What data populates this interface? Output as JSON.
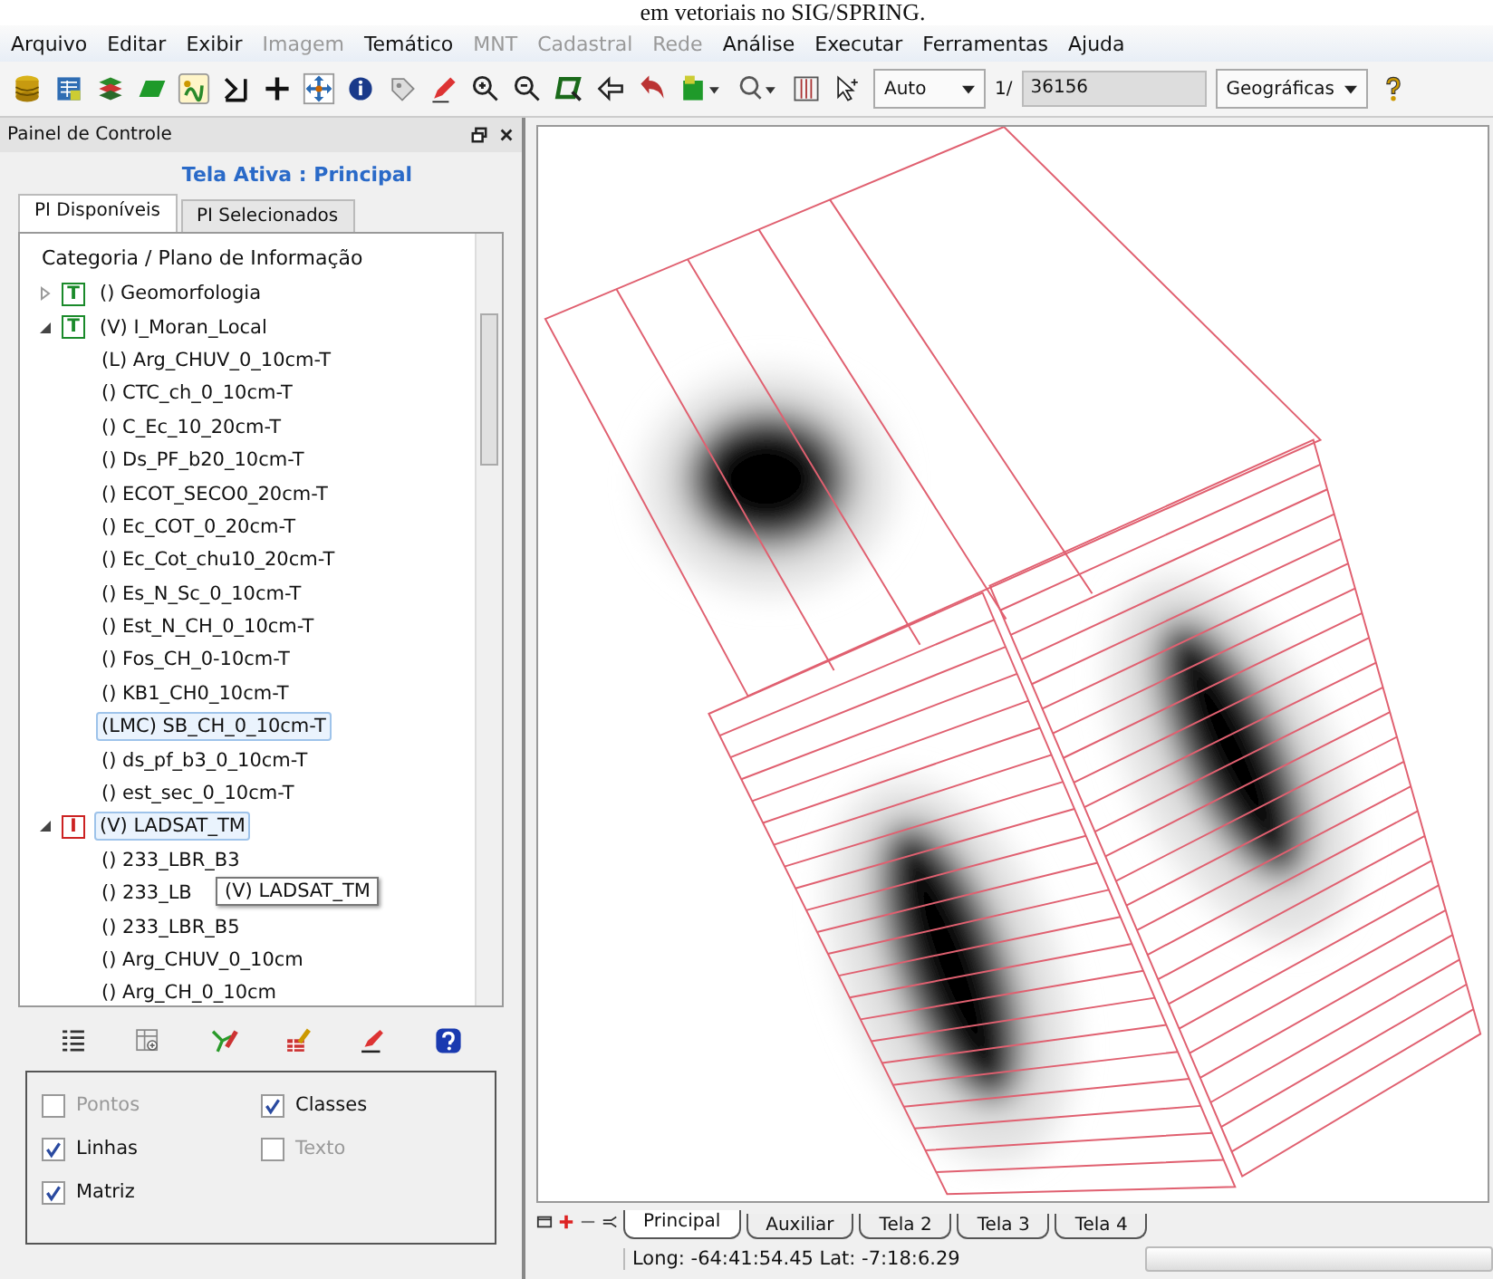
{
  "caption": "em vetoriais no SIG/SPRING.",
  "menu": [
    {
      "label": "Arquivo",
      "disabled": false
    },
    {
      "label": "Editar",
      "disabled": false
    },
    {
      "label": "Exibir",
      "disabled": false
    },
    {
      "label": "Imagem",
      "disabled": true
    },
    {
      "label": "Temático",
      "disabled": false
    },
    {
      "label": "MNT",
      "disabled": true
    },
    {
      "label": "Cadastral",
      "disabled": true
    },
    {
      "label": "Rede",
      "disabled": true
    },
    {
      "label": "Análise",
      "disabled": false
    },
    {
      "label": "Executar",
      "disabled": false
    },
    {
      "label": "Ferramentas",
      "disabled": false
    },
    {
      "label": "Ajuda",
      "disabled": false
    }
  ],
  "toolbar": {
    "zoom_mode": "Auto",
    "scale_prefix": "1/",
    "scale": "36156",
    "projection": "Geográficas"
  },
  "panel": {
    "title": "Painel de Controle",
    "active_screen": "Tela Ativa : Principal",
    "tabs": [
      {
        "label": "PI Disponíveis",
        "selected": true
      },
      {
        "label": "PI Selecionados",
        "selected": false
      }
    ],
    "tree_header": "Categoria / Plano de Informação",
    "tree": [
      {
        "label": "() Geomorfologia",
        "badge": "T",
        "color": "#1a8a2a",
        "expanded": false,
        "selected": false
      },
      {
        "label": "(V) I_Moran_Local",
        "badge": "T",
        "color": "#1a8a2a",
        "expanded": true,
        "selected": false,
        "children": [
          {
            "label": "(L) Arg_CHUV_0_10cm-T",
            "selected": false
          },
          {
            "label": "() CTC_ch_0_10cm-T",
            "selected": false
          },
          {
            "label": "() C_Ec_10_20cm-T",
            "selected": false
          },
          {
            "label": "() Ds_PF_b20_10cm-T",
            "selected": false
          },
          {
            "label": "() ECOT_SECO0_20cm-T",
            "selected": false
          },
          {
            "label": "() Ec_COT_0_20cm-T",
            "selected": false
          },
          {
            "label": "() Ec_Cot_chu10_20cm-T",
            "selected": false
          },
          {
            "label": "() Es_N_Sc_0_10cm-T",
            "selected": false
          },
          {
            "label": "() Est_N_CH_0_10cm-T",
            "selected": false
          },
          {
            "label": "() Fos_CH_0-10cm-T",
            "selected": false
          },
          {
            "label": "() KB1_CH0_10cm-T",
            "selected": false
          },
          {
            "label": "(LMC) SB_CH_0_10cm-T",
            "selected": true
          },
          {
            "label": "() ds_pf_b3_0_10cm-T",
            "selected": false
          },
          {
            "label": "() est_sec_0_10cm-T",
            "selected": false
          }
        ]
      },
      {
        "label": "(V) LADSAT_TM",
        "badge": "I",
        "color": "#cc2222",
        "expanded": true,
        "selected": true,
        "children": [
          {
            "label": "() 233_LBR_B3",
            "selected": false
          },
          {
            "label": "() 233_LB",
            "selected": false
          },
          {
            "label": "() 233_LBR_B5",
            "selected": false
          },
          {
            "label": "() Arg_CHUV_0_10cm",
            "selected": false
          },
          {
            "label": "() Arg_CH_0_10cm",
            "selected": false
          }
        ]
      }
    ],
    "tooltip": "(V) LADSAT_TM",
    "options": [
      {
        "label": "Pontos",
        "checked": false,
        "disabled": true
      },
      {
        "label": "Classes",
        "checked": true,
        "disabled": false
      },
      {
        "label": "Linhas",
        "checked": true,
        "disabled": false
      },
      {
        "label": "Texto",
        "checked": false,
        "disabled": true
      },
      {
        "label": "Matriz",
        "checked": true,
        "disabled": false
      }
    ]
  },
  "screen_tabs": [
    {
      "label": "Principal",
      "selected": true
    },
    {
      "label": "Auxiliar",
      "selected": false
    },
    {
      "label": "Tela 2",
      "selected": false
    },
    {
      "label": "Tela 3",
      "selected": false
    },
    {
      "label": "Tela 4",
      "selected": false
    }
  ],
  "status": {
    "coordinates": "Long: -64:41:54.45 Lat: -7:18:6.29"
  }
}
